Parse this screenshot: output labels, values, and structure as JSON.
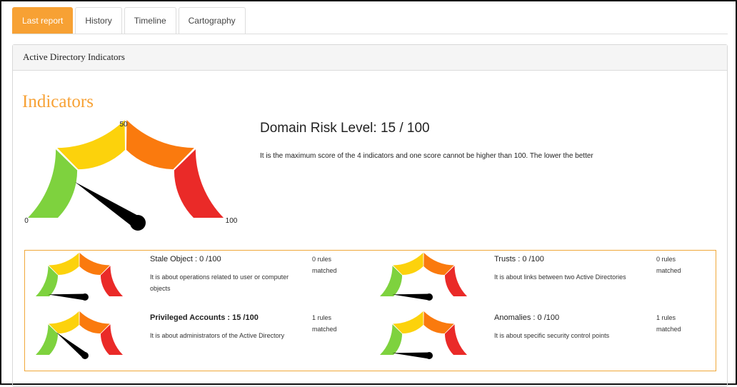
{
  "tabs": [
    {
      "label": "Last report",
      "active": true
    },
    {
      "label": "History",
      "active": false
    },
    {
      "label": "Timeline",
      "active": false
    },
    {
      "label": "Cartography",
      "active": false
    }
  ],
  "panel": {
    "title": "Active Directory Indicators",
    "section_title": "Indicators",
    "gauge": {
      "min_label": "0",
      "mid_label": "50",
      "max_label": "100",
      "value": 15
    },
    "risk": {
      "title": "Domain Risk Level: 15 / 100",
      "description": "It is the maximum score of the 4 indicators and one score cannot be higher than 100. The lower the better"
    },
    "indicators": [
      {
        "title": "Stale Object : 0 /100",
        "value": 0,
        "description": "It is about operations related to user or computer objects",
        "rules": "0 rules matched",
        "bold": false
      },
      {
        "title": "Trusts : 0 /100",
        "value": 0,
        "description": "It is about links between two Active Directories",
        "rules": "0 rules matched",
        "bold": false
      },
      {
        "title": "Privileged Accounts : 15 /100",
        "value": 15,
        "description": "It is about administrators of the Active Directory",
        "rules": "1 rules matched",
        "bold": true
      },
      {
        "title": "Anomalies : 0 /100",
        "value": 0,
        "description": "It is about specific security control points",
        "rules": "1 rules matched",
        "bold": false
      }
    ]
  },
  "colors": {
    "accent": "#f7a134",
    "gauge_segments": [
      "#7ed23e",
      "#fcd20c",
      "#fa7a0e",
      "#ea2a28"
    ],
    "needle": "#000000"
  }
}
